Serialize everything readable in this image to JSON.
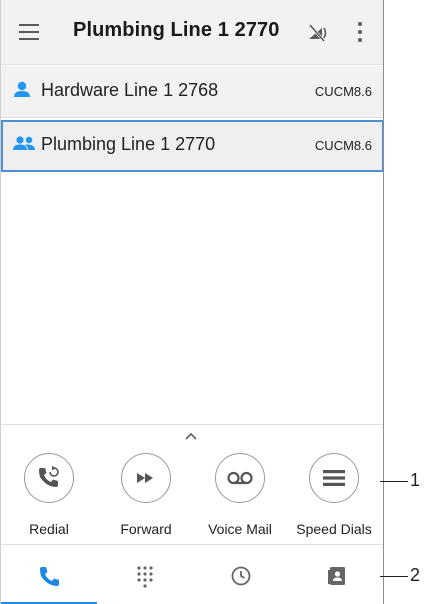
{
  "app_bar": {
    "title": "Plumbing Line 1 2770",
    "menu_icon": "hamburger-menu-icon",
    "network_icon": "network-status-icon",
    "overflow_icon": "more-vertical-icon"
  },
  "lines": [
    {
      "icon": "single-person-icon",
      "label": "Hardware Line 1 2768",
      "server": "CUCM8.6",
      "selected": false
    },
    {
      "icon": "shared-line-icon",
      "label": "Plumbing Line 1 2770",
      "server": "CUCM8.6",
      "selected": true
    }
  ],
  "actions": [
    {
      "icon": "redial-icon",
      "label": "Redial"
    },
    {
      "icon": "forward-icon",
      "label": "Forward"
    },
    {
      "icon": "voicemail-icon",
      "label": "Voice Mail"
    },
    {
      "icon": "speed-dials-icon",
      "label": "Speed Dials"
    }
  ],
  "tabs": [
    {
      "icon": "phone-icon",
      "active": true
    },
    {
      "icon": "dialpad-icon",
      "active": false
    },
    {
      "icon": "recents-clock-icon",
      "active": false
    },
    {
      "icon": "contacts-icon",
      "active": false
    }
  ],
  "callouts": [
    "1",
    "2"
  ],
  "colors": {
    "accent": "#1e88e5",
    "selection_border": "#4a90d2",
    "line_icon_blue": "#2196f3",
    "icon_gray": "#5a5a5a",
    "app_bar_bg": "#f2f2f2"
  }
}
